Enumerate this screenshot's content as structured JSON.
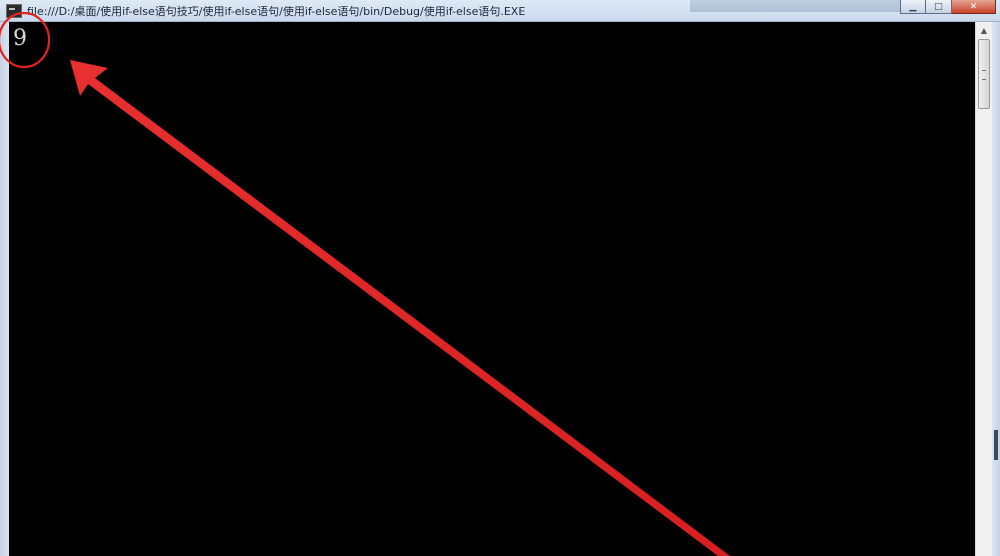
{
  "window": {
    "title": "file:///D:/桌面/使用if-else语句技巧/使用if-else语句/使用if-else语句/bin/Debug/使用if-else语句.EXE",
    "icon": "console-app-icon",
    "caption_buttons": {
      "minimize": "▁",
      "maximize": "□",
      "close": "✕"
    }
  },
  "console": {
    "background_color": "#000000",
    "text_color": "#d8d8d8",
    "output": "9"
  },
  "scrollbar": {
    "up_arrow": "▲"
  },
  "annotation": {
    "color": "#e02424",
    "shapes": [
      "circle-highlight",
      "arrow-pointer"
    ]
  }
}
